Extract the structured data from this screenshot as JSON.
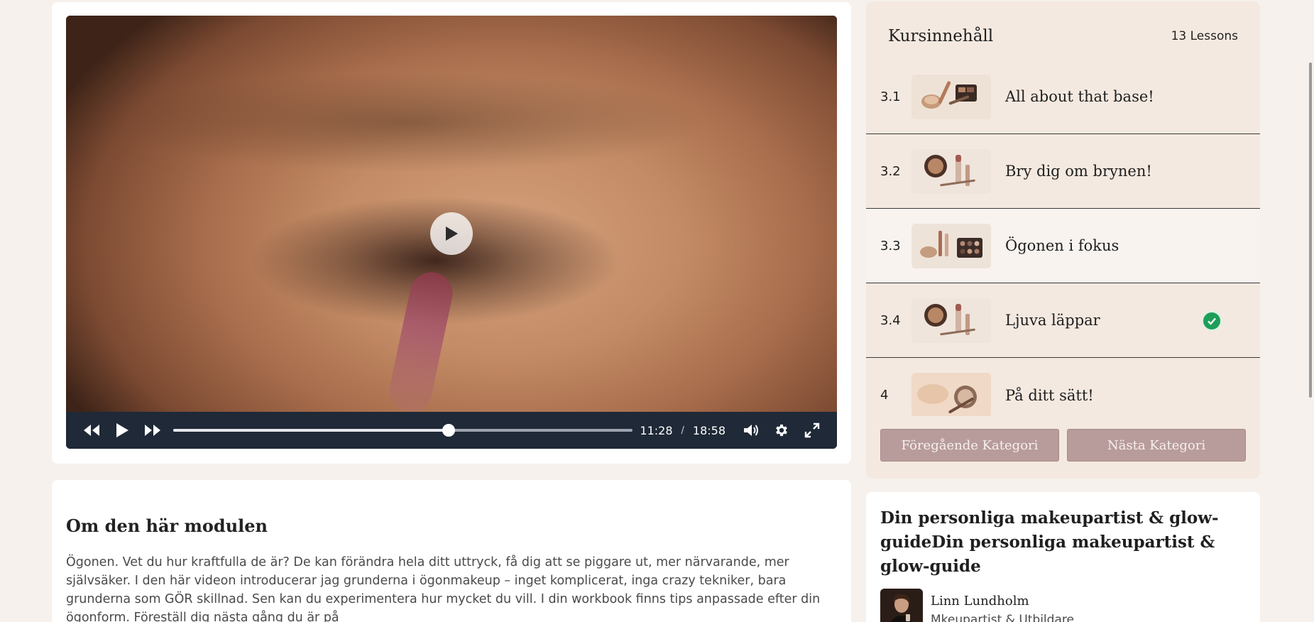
{
  "video": {
    "current_time": "11:28",
    "time_separator": "/",
    "duration": "18:58",
    "progress": 0.6,
    "controls": {
      "rewind_icon": "rewind-icon",
      "play_icon": "play-icon",
      "fast_forward_icon": "fast-forward-icon",
      "volume_icon": "volume-icon",
      "settings_icon": "gear-icon",
      "fullscreen_icon": "fullscreen-icon"
    }
  },
  "about": {
    "title": "Om den här modulen",
    "text": "Ögonen. Vet du hur kraftfulla de är? De kan förändra hela ditt uttryck, få dig att se piggare ut, mer närvarande, mer självsäker. I den här videon introducerar jag grunderna i ögonmakeup – inget komplicerat, inga crazy tekniker, bara grunderna som GÖR skillnad. Sen kan du experimentera hur mycket du vill. I din workbook finns tips anpassade efter din ögonform. Föreställ dig nästa gång du är på"
  },
  "course": {
    "title": "Kursinnehåll",
    "lesson_count": "13 Lessons",
    "lessons": [
      {
        "number": "3.1",
        "title": "All about that base!",
        "active": false,
        "completed": false
      },
      {
        "number": "3.2",
        "title": "Bry dig om brynen!",
        "active": false,
        "completed": false
      },
      {
        "number": "3.3",
        "title": "Ögonen i fokus",
        "active": true,
        "completed": false
      },
      {
        "number": "3.4",
        "title": "Ljuva läppar",
        "active": false,
        "completed": true
      },
      {
        "number": "4",
        "title": "På ditt sätt!",
        "active": false,
        "completed": false
      }
    ],
    "prev_button": "Föregående Kategori",
    "next_button": "Nästa Kategori"
  },
  "guide": {
    "title": "Din personliga makeupartist & glow-guideDin personliga makeupartist & glow-guide",
    "author_name": "Linn Lundholm",
    "author_role": "Mkeupartist & Utbildare"
  },
  "colors": {
    "page_bg": "#f6f1ec",
    "panel_bg": "#f4e9e0",
    "control_bar": "#1f2937",
    "button_bg": "#b89c9c",
    "check_green": "#1e9e58"
  }
}
